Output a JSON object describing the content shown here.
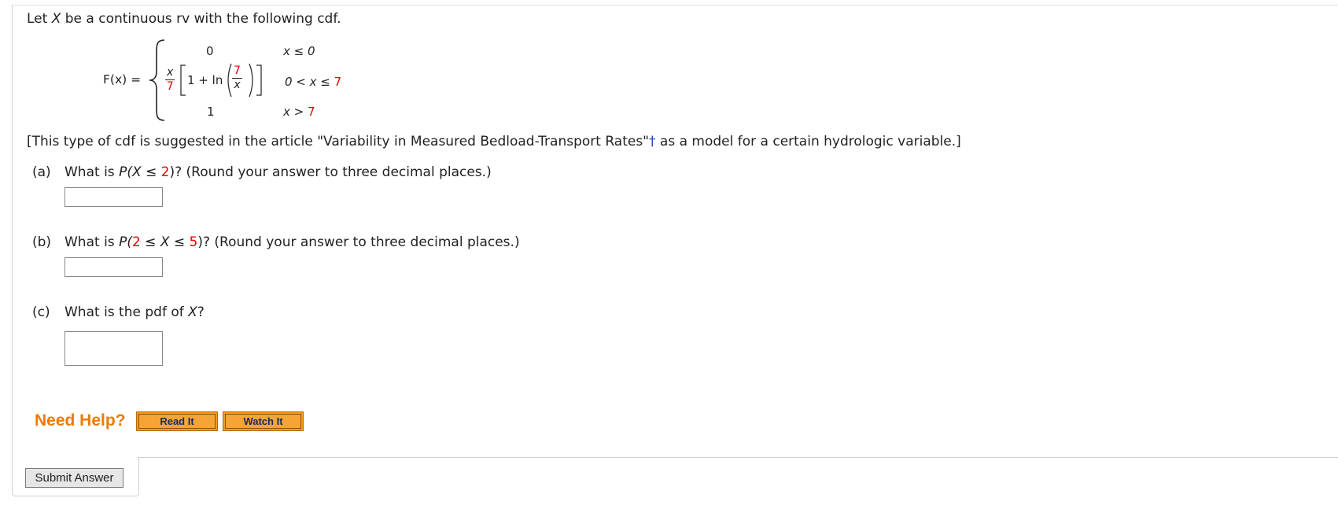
{
  "intro": {
    "pre": "Let ",
    "var": "X",
    "post": " be a continuous rv with the following cdf."
  },
  "formula": {
    "lhs": "F(x) =",
    "case1_value": "0",
    "case1_cond": "x ≤ 0",
    "case2_frac_num": "x",
    "case2_frac_den": "7",
    "case2_mid": "1 + ln",
    "case2_inner_num": "7",
    "case2_inner_den": "x",
    "case2_cond_pre": "0 < x ≤ ",
    "case2_cond_val": "7",
    "case3_value": "1",
    "case3_cond_pre": "x > ",
    "case3_cond_val": "7"
  },
  "note": {
    "pre": "[This type of cdf is suggested in the article \"Variability in Measured Bedload-Transport Rates\"",
    "dagger": "†",
    "post": " as a model for a certain hydrologic variable.]"
  },
  "questions": {
    "a": {
      "label": "(a)",
      "t1": "What is ",
      "t2": "P(X ≤ ",
      "v1": "2",
      "t3": ")? (Round your answer to three decimal places.)",
      "value": ""
    },
    "b": {
      "label": "(b)",
      "t1": "What is ",
      "t2": "P(",
      "v1": "2",
      "t3": " ≤ X ≤ ",
      "v2": "5",
      "t4": ")? (Round your answer to three decimal places.)",
      "value": ""
    },
    "c": {
      "label": "(c)",
      "t1": "What is the pdf of ",
      "t2": "X",
      "t3": "?",
      "value": ""
    }
  },
  "help": {
    "title": "Need Help?",
    "read_it": "Read It",
    "watch_it": "Watch It"
  },
  "submit": {
    "label": "Submit Answer"
  },
  "colors": {
    "highlight": "#e00000",
    "help_title": "#ec7a00",
    "help_button": "#f39c1e"
  }
}
